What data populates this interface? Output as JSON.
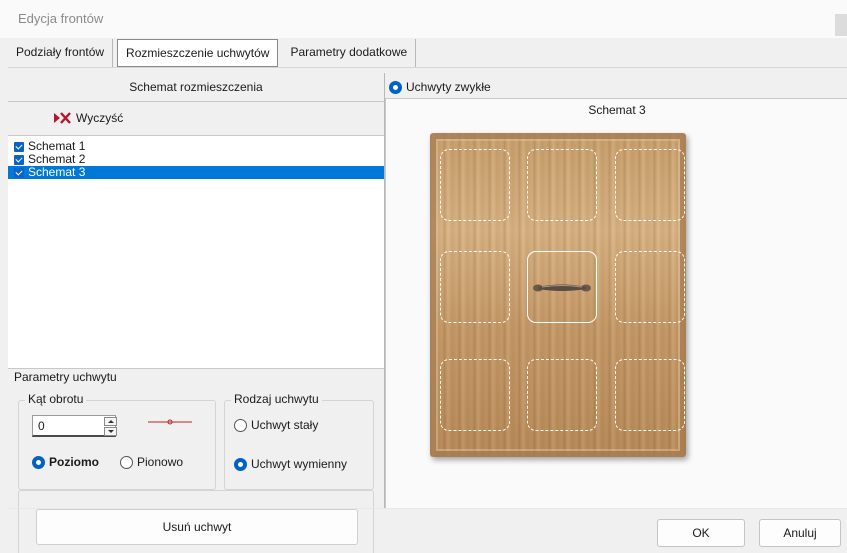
{
  "window": {
    "title": "Edycja frontów"
  },
  "tabs": [
    {
      "label": "Podziały frontów"
    },
    {
      "label": "Rozmieszczenie uchwytów"
    },
    {
      "label": "Parametry dodatkowe"
    }
  ],
  "left": {
    "header": "Schemat rozmieszczenia",
    "clear_label": "Wyczyść",
    "schemes": [
      {
        "label": "Schemat 1",
        "checked": true
      },
      {
        "label": "Schemat 2",
        "checked": true
      },
      {
        "label": "Schemat 3",
        "checked": true,
        "selected": true
      }
    ]
  },
  "params": {
    "legend": "Parametry uchwytu",
    "angle": {
      "legend": "Kąt obrotu",
      "value": "0",
      "horizontal_label": "Poziomo",
      "vertical_label": "Pionowo",
      "selected": "Poziomo"
    },
    "handle_type": {
      "legend": "Rodzaj uchwytu",
      "fixed_label": "Uchwyt stały",
      "replaceable_label": "Uchwyt wymienny",
      "selected": "Uchwyt wymienny"
    },
    "delete_label": "Usuń uchwyt"
  },
  "right": {
    "radio_label": "Uchwyty zwykłe",
    "schema_title": "Schemat 3",
    "accent_color": "#0062c4"
  },
  "footer": {
    "ok_label": "OK",
    "cancel_label": "Anuluj"
  }
}
